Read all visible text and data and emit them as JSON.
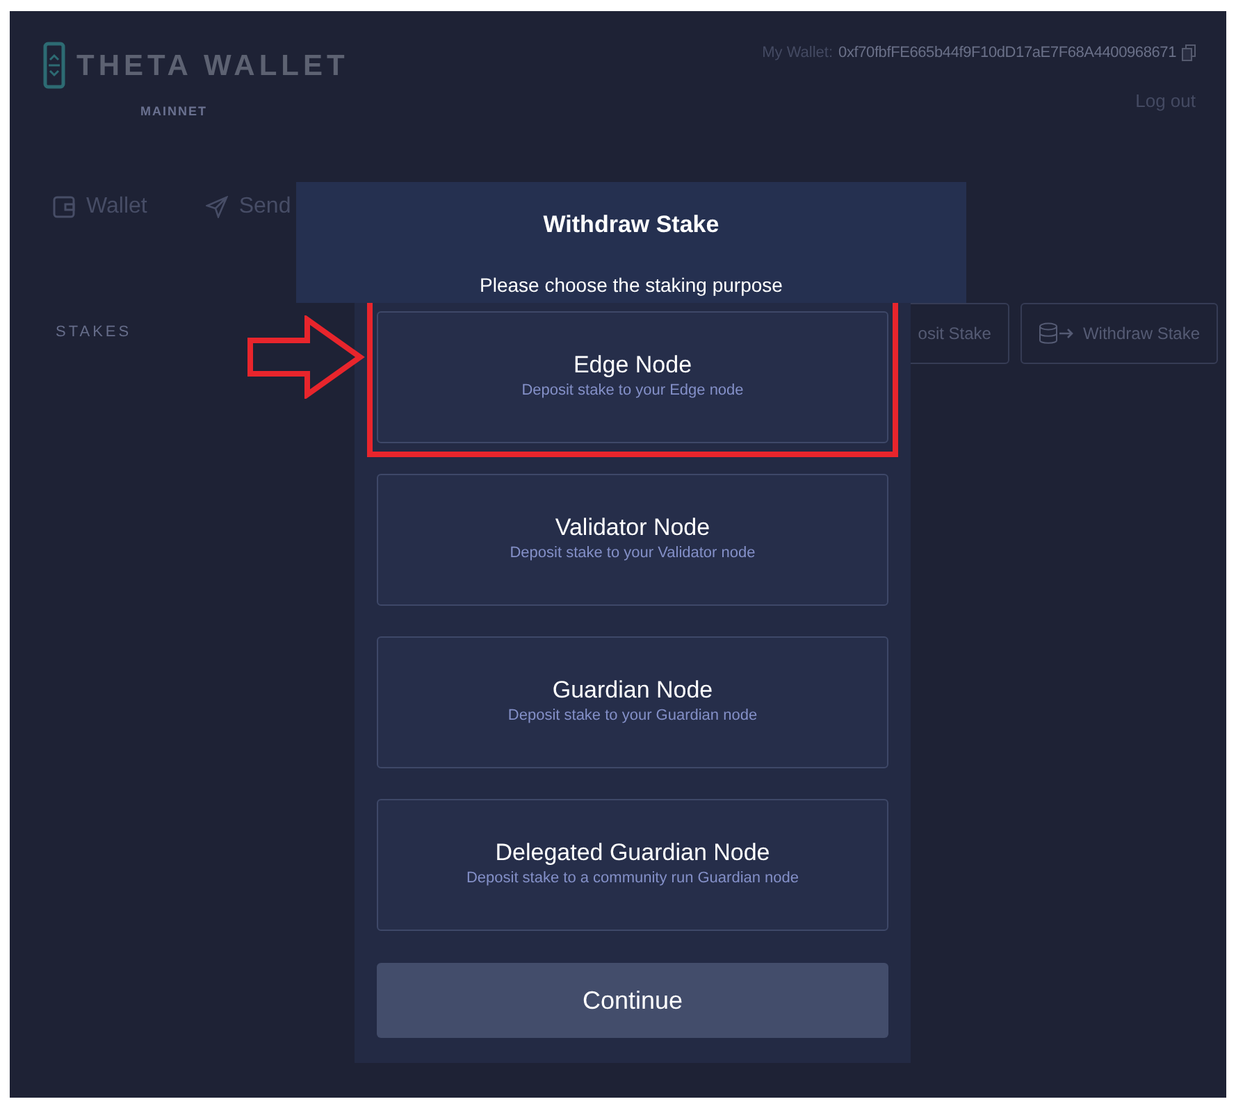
{
  "header": {
    "logo_text": "THETA WALLET",
    "network": "MAINNET",
    "wallet_label": "My Wallet:",
    "wallet_address": "0xf70fbfFE665b44f9F10dD17aE7F68A4400968671",
    "logout": "Log out"
  },
  "nav": [
    {
      "label": "Wallet"
    },
    {
      "label": "Send"
    }
  ],
  "stakes": {
    "title": "STAKES",
    "buttons": [
      {
        "label": "osit Stake"
      },
      {
        "label": "Withdraw Stake"
      }
    ]
  },
  "modal": {
    "title": "Withdraw Stake",
    "subtitle": "Please choose the staking purpose",
    "options": [
      {
        "title": "Edge Node",
        "description": "Deposit stake to your Edge node",
        "highlighted": true
      },
      {
        "title": "Validator Node",
        "description": "Deposit stake to your Validator node",
        "highlighted": false
      },
      {
        "title": "Guardian Node",
        "description": "Deposit stake to your Guardian node",
        "highlighted": false
      },
      {
        "title": "Delegated Guardian Node",
        "description": "Deposit stake to a community run Guardian node",
        "highlighted": false
      }
    ],
    "continue_button": "Continue"
  }
}
